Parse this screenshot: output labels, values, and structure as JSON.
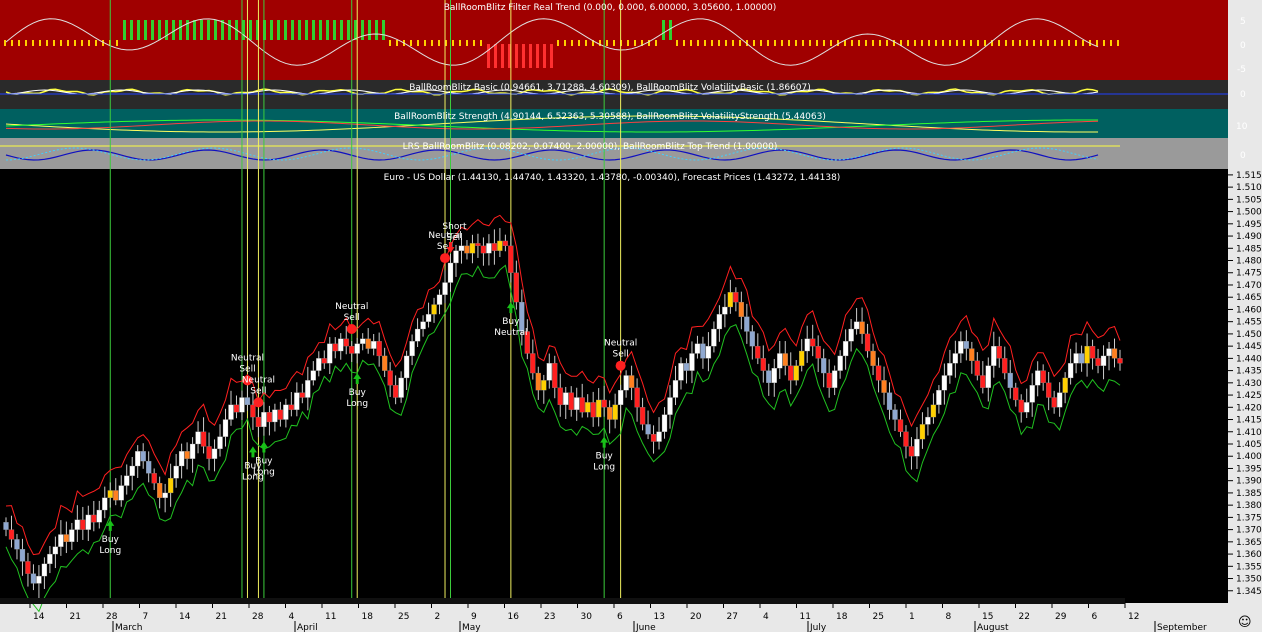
{
  "panels": {
    "filter": {
      "title": "BallRoomBlitz Filter Real Trend (0.000, 0.000, 6.00000, 3.05600, 1.00000)",
      "ticks": [
        "5",
        "0",
        "-5"
      ],
      "bg": "#a00000"
    },
    "basic": {
      "title": "BallRoomBlitz Basic (0.94661, 3.71288, 4.60309), BallRoomBlitz VolatilityBasic (1.86607)",
      "ticks": [
        "0"
      ],
      "bg": "#2a2a2a"
    },
    "strength": {
      "title": "BallRoomBlitz Strength (4.90144, 6.52363, 5.30588), BallRoomBlitz VolatilityStrength (5.44063)",
      "ticks": [
        "10"
      ],
      "bg": "#006060"
    },
    "lrs": {
      "title": "LRS BallRoomBlitz (0.08202, 0.07400, 2.00000), BallRoomBlitz Top Trend (1.00000)",
      "ticks": [
        "0"
      ],
      "bg": "#9a9a9a"
    },
    "price": {
      "title": "Euro - US Dollar (1.44130, 1.44740, 1.43320, 1.43780, -0.00340), Forecast Prices (1.43272, 1.44138)"
    }
  },
  "chart_data": {
    "type": "candlestick",
    "symbol": "Euro - US Dollar",
    "ylim": [
      1.34,
      1.517
    ],
    "y_ticks": [
      "1.515",
      "1.510",
      "1.505",
      "1.500",
      "1.495",
      "1.490",
      "1.485",
      "1.480",
      "1.475",
      "1.470",
      "1.465",
      "1.460",
      "1.455",
      "1.450",
      "1.445",
      "1.440",
      "1.435",
      "1.430",
      "1.425",
      "1.420",
      "1.415",
      "1.410",
      "1.405",
      "1.400",
      "1.395",
      "1.390",
      "1.385",
      "1.380",
      "1.375",
      "1.370",
      "1.365",
      "1.360",
      "1.355",
      "1.350",
      "1.345"
    ],
    "x_day_ticks": [
      "14",
      "21",
      "28",
      "7",
      "14",
      "21",
      "28",
      "4",
      "11",
      "18",
      "25",
      "2",
      "9",
      "16",
      "23",
      "30",
      "6",
      "13",
      "20",
      "27",
      "4",
      "11",
      "18",
      "25",
      "1",
      "8",
      "15",
      "22",
      "29",
      "6",
      "12"
    ],
    "x_month_labels": [
      "March",
      "April",
      "May",
      "June",
      "July",
      "August",
      "September"
    ],
    "bar_count": 200,
    "close": [
      1.37,
      1.366,
      1.362,
      1.357,
      1.352,
      1.348,
      1.351,
      1.356,
      1.36,
      1.363,
      1.368,
      1.365,
      1.37,
      1.374,
      1.37,
      1.376,
      1.373,
      1.378,
      1.383,
      1.386,
      1.382,
      1.388,
      1.392,
      1.396,
      1.402,
      1.398,
      1.393,
      1.389,
      1.383,
      1.385,
      1.391,
      1.396,
      1.402,
      1.399,
      1.405,
      1.41,
      1.404,
      1.399,
      1.403,
      1.408,
      1.415,
      1.421,
      1.418,
      1.424,
      1.421,
      1.416,
      1.412,
      1.418,
      1.414,
      1.419,
      1.415,
      1.421,
      1.419,
      1.426,
      1.424,
      1.431,
      1.435,
      1.44,
      1.438,
      1.446,
      1.443,
      1.448,
      1.445,
      1.442,
      1.446,
      1.448,
      1.444,
      1.447,
      1.441,
      1.435,
      1.429,
      1.424,
      1.432,
      1.441,
      1.447,
      1.452,
      1.455,
      1.458,
      1.462,
      1.466,
      1.471,
      1.479,
      1.484,
      1.486,
      1.483,
      1.487,
      1.486,
      1.483,
      1.487,
      1.484,
      1.488,
      1.486,
      1.475,
      1.463,
      1.451,
      1.442,
      1.434,
      1.427,
      1.431,
      1.438,
      1.428,
      1.421,
      1.426,
      1.419,
      1.424,
      1.418,
      1.422,
      1.416,
      1.423,
      1.42,
      1.415,
      1.421,
      1.427,
      1.433,
      1.428,
      1.42,
      1.413,
      1.409,
      1.406,
      1.41,
      1.417,
      1.424,
      1.431,
      1.438,
      1.435,
      1.442,
      1.446,
      1.44,
      1.445,
      1.452,
      1.458,
      1.461,
      1.467,
      1.463,
      1.457,
      1.451,
      1.445,
      1.44,
      1.435,
      1.43,
      1.436,
      1.442,
      1.437,
      1.431,
      1.437,
      1.443,
      1.448,
      1.445,
      1.44,
      1.434,
      1.428,
      1.435,
      1.441,
      1.447,
      1.452,
      1.455,
      1.45,
      1.443,
      1.437,
      1.431,
      1.426,
      1.419,
      1.415,
      1.41,
      1.404,
      1.4,
      1.407,
      1.413,
      1.416,
      1.421,
      1.427,
      1.433,
      1.438,
      1.442,
      1.447,
      1.444,
      1.439,
      1.433,
      1.428,
      1.437,
      1.445,
      1.44,
      1.434,
      1.428,
      1.423,
      1.418,
      1.422,
      1.429,
      1.435,
      1.43,
      1.424,
      1.42,
      1.426,
      1.432,
      1.438,
      1.442,
      1.438,
      1.445,
      1.44,
      1.437,
      1.441,
      1.444,
      1.44,
      1.438
    ],
    "signals": [
      {
        "bar": 19,
        "label": "Buy Long",
        "type": "buy"
      },
      {
        "bar": 44,
        "label": "Neutral Sell",
        "type": "neutral-sell"
      },
      {
        "bar": 45,
        "label": "Buy Long",
        "type": "buy"
      },
      {
        "bar": 46,
        "label": "Neutral Sell",
        "type": "neutral-sell"
      },
      {
        "bar": 47,
        "label": "Buy Long",
        "type": "buy"
      },
      {
        "bar": 63,
        "label": "Neutral Sell",
        "type": "neutral-sell"
      },
      {
        "bar": 64,
        "label": "Buy Long",
        "type": "buy"
      },
      {
        "bar": 80,
        "label": "Neutral Sell",
        "type": "neutral-sell"
      },
      {
        "bar": 81,
        "label": "Short Sell",
        "type": "short"
      },
      {
        "bar": 92,
        "label": "Buy Neutral",
        "type": "buy-neutral"
      },
      {
        "bar": 109,
        "label": "Buy Long",
        "type": "buy"
      },
      {
        "bar": 112,
        "label": "Neutral Sell",
        "type": "neutral-sell"
      }
    ],
    "vlines": [
      {
        "bar": 19,
        "color": "#3ccc3c"
      },
      {
        "bar": 43,
        "color": "#3ccc3c"
      },
      {
        "bar": 44,
        "color": "#f0f060"
      },
      {
        "bar": 46,
        "color": "#f0f060"
      },
      {
        "bar": 47,
        "color": "#3ccc3c"
      },
      {
        "bar": 63,
        "color": "#3ccc3c"
      },
      {
        "bar": 64,
        "color": "#f0f060"
      },
      {
        "bar": 80,
        "color": "#f0f060"
      },
      {
        "bar": 81,
        "color": "#3ccc3c"
      },
      {
        "bar": 92,
        "color": "#f0f060"
      },
      {
        "bar": 109,
        "color": "#3ccc3c"
      },
      {
        "bar": 112,
        "color": "#f0f060"
      }
    ],
    "colors": {
      "up": "#ffffff",
      "down": "#ff2020",
      "yellow": "#ffd000",
      "orange": "#ff8020",
      "blue": "#8fa8d0",
      "upper_band": "#ff2020",
      "lower_band": "#20c020"
    }
  },
  "footer": {
    "smiley": "☺"
  }
}
